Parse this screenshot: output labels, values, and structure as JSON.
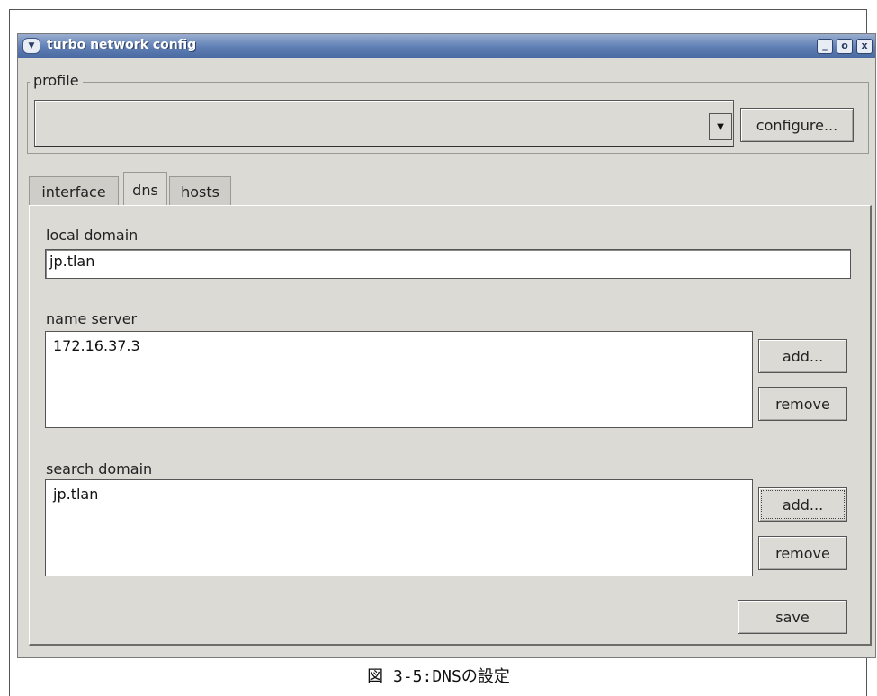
{
  "window": {
    "title": "turbo network config",
    "menu_icon": "chevron-down-icon",
    "controls": [
      "minimize-icon",
      "maximize-icon",
      "close-icon"
    ],
    "minimize_glyph": "_",
    "maximize_glyph": "o",
    "close_glyph": "x"
  },
  "profile": {
    "legend": "profile",
    "selected_value": "",
    "configure_label": "configure..."
  },
  "tabs": [
    {
      "label": "interface",
      "active": false
    },
    {
      "label": "dns",
      "active": true
    },
    {
      "label": "hosts",
      "active": false
    }
  ],
  "dns": {
    "local_domain_label": "local domain",
    "local_domain_value": "jp.tlan",
    "name_server_label": "name server",
    "name_servers": [
      "172.16.37.3"
    ],
    "name_server_add_label": "add...",
    "name_server_remove_label": "remove",
    "search_domain_label": "search domain",
    "search_domains": [
      "jp.tlan"
    ],
    "search_domain_add_label": "add...",
    "search_domain_remove_label": "remove",
    "save_label": "save"
  },
  "caption": "図 3-5:DNSの設定",
  "colors": {
    "window_bg": "#dcdad5",
    "titlebar": "#5f7fb4",
    "field_bg": "#ffffff"
  }
}
